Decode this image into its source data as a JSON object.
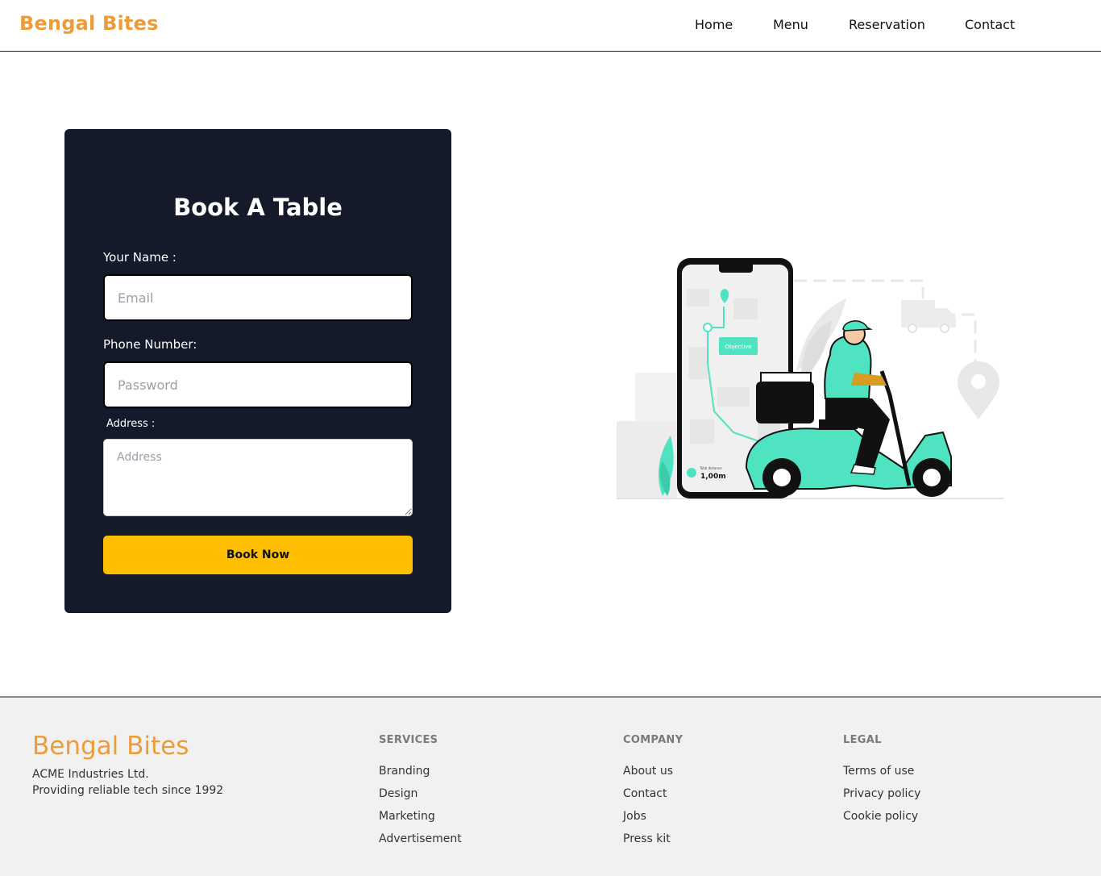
{
  "header": {
    "brand": "Bengal Bites",
    "nav": [
      "Home",
      "Menu",
      "Reservation",
      "Contact"
    ]
  },
  "form": {
    "title": "Book A Table",
    "name_label": "Your Name :",
    "name_placeholder": "Email",
    "phone_label": "Phone Number:",
    "phone_placeholder": "Password",
    "address_label": "Address :",
    "address_placeholder": "Address",
    "submit_label": "Book Now"
  },
  "illustration": {
    "pin_label": "Objective",
    "distance_caption": "Total distance",
    "distance_value": "1,00m"
  },
  "footer": {
    "brand": "Bengal Bites",
    "company": "ACME Industries Ltd.",
    "tagline": "Providing reliable tech since 1992",
    "columns": [
      {
        "heading": "SERVICES",
        "links": [
          "Branding",
          "Design",
          "Marketing",
          "Advertisement"
        ]
      },
      {
        "heading": "COMPANY",
        "links": [
          "About us",
          "Contact",
          "Jobs",
          "Press kit"
        ]
      },
      {
        "heading": "LEGAL",
        "links": [
          "Terms of use",
          "Privacy policy",
          "Cookie policy"
        ]
      }
    ]
  },
  "colors": {
    "brand": "#eb9c3b",
    "card_bg": "#141a2a",
    "button": "#ffbe00",
    "illustration_accent": "#4fe3c1",
    "footer_bg": "#f1f1f1"
  }
}
